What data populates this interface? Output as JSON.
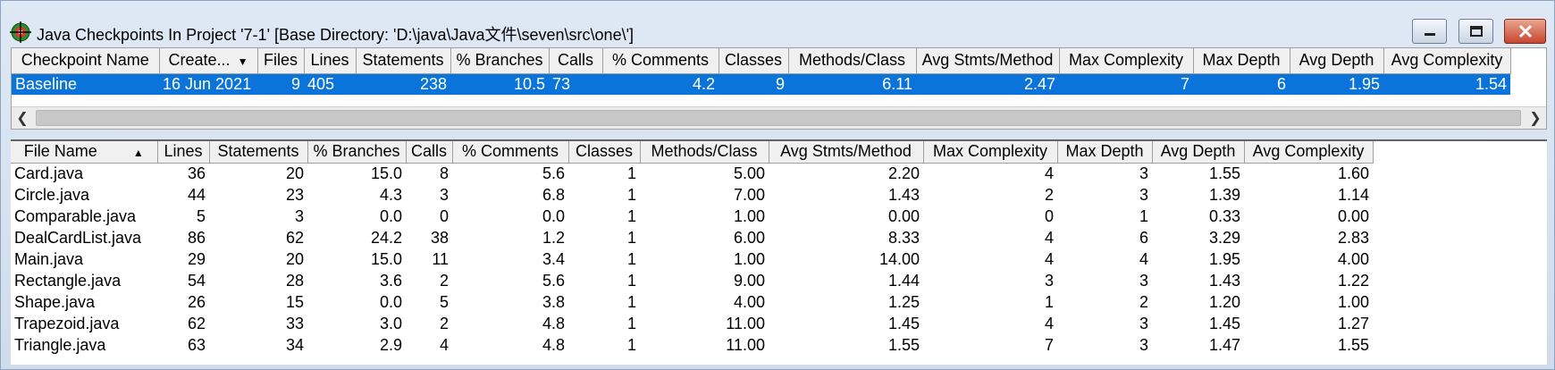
{
  "window": {
    "title": "Java Checkpoints In Project '7-1'  [Base Directory: 'D:\\java\\Java文件\\seven\\src\\one\\']",
    "icon": "target-icon"
  },
  "checkpoints": {
    "columns": [
      "Checkpoint Name",
      "Create...",
      "Files",
      "Lines",
      "Statements",
      "% Branches",
      "Calls",
      "% Comments",
      "Classes",
      "Methods/Class",
      "Avg Stmts/Method",
      "Max Complexity",
      "Max Depth",
      "Avg Depth",
      "Avg Complexity"
    ],
    "rows": [
      [
        "Baseline",
        "16 Jun 2021",
        "9",
        "405",
        "238",
        "10.5",
        "73",
        "4.2",
        "9",
        "6.11",
        "2.47",
        "7",
        "6",
        "1.95",
        "1.54"
      ]
    ]
  },
  "files": {
    "columns": [
      "File Name",
      "Lines",
      "Statements",
      "% Branches",
      "Calls",
      "% Comments",
      "Classes",
      "Methods/Class",
      "Avg Stmts/Method",
      "Max Complexity",
      "Max Depth",
      "Avg Depth",
      "Avg Complexity"
    ],
    "rows": [
      [
        "Card.java",
        "36",
        "20",
        "15.0",
        "8",
        "5.6",
        "1",
        "5.00",
        "2.20",
        "4",
        "3",
        "1.55",
        "1.60"
      ],
      [
        "Circle.java",
        "44",
        "23",
        "4.3",
        "3",
        "6.8",
        "1",
        "7.00",
        "1.43",
        "2",
        "3",
        "1.39",
        "1.14"
      ],
      [
        "Comparable.java",
        "5",
        "3",
        "0.0",
        "0",
        "0.0",
        "1",
        "1.00",
        "0.00",
        "0",
        "1",
        "0.33",
        "0.00"
      ],
      [
        "DealCardList.java",
        "86",
        "62",
        "24.2",
        "38",
        "1.2",
        "1",
        "6.00",
        "8.33",
        "4",
        "6",
        "3.29",
        "2.83"
      ],
      [
        "Main.java",
        "29",
        "20",
        "15.0",
        "11",
        "3.4",
        "1",
        "1.00",
        "14.00",
        "4",
        "4",
        "1.95",
        "4.00"
      ],
      [
        "Rectangle.java",
        "54",
        "28",
        "3.6",
        "2",
        "5.6",
        "1",
        "9.00",
        "1.44",
        "3",
        "3",
        "1.43",
        "1.22"
      ],
      [
        "Shape.java",
        "26",
        "15",
        "0.0",
        "5",
        "3.8",
        "1",
        "4.00",
        "1.25",
        "1",
        "2",
        "1.20",
        "1.00"
      ],
      [
        "Trapezoid.java",
        "62",
        "33",
        "3.0",
        "2",
        "4.8",
        "1",
        "11.00",
        "1.45",
        "4",
        "3",
        "1.45",
        "1.27"
      ],
      [
        "Triangle.java",
        "63",
        "34",
        "2.9",
        "4",
        "4.8",
        "1",
        "11.00",
        "1.55",
        "7",
        "3",
        "1.47",
        "1.55"
      ]
    ]
  },
  "colors": {
    "selection": "#0a74da",
    "close_button": "#c8462f"
  }
}
